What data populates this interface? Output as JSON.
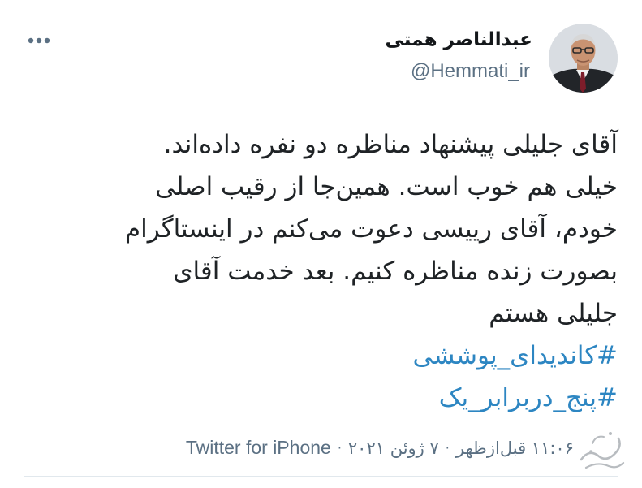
{
  "tweet": {
    "author_name": "عبدالناصر همتی",
    "author_handle": "@Hemmati_ir",
    "body_lines": [
      "آقای جلیلی پیشنهاد مناظره دو نفره داده‌اند.",
      "خیلی هم خوب است. همین‌جا از رقیب اصلی",
      "خودم، آقای رییسی دعوت می‌کنم در اینستاگرام",
      "بصورت زنده مناظره کنیم. بعد خدمت آقای",
      "جلیلی هستم"
    ],
    "hashtags": [
      "#کاندیدای_پوششی",
      "#پنج_دربرابر_یک"
    ],
    "time": "۱۱:۰۶ قبل‌ازظهر",
    "separator": "·",
    "date": "۷ ژوئن ۲۰۲۱",
    "source": "Twitter for iPhone"
  },
  "icons": {
    "more": "more-horizontal-icon",
    "avatar": "avatar-photo",
    "watermark": "calligraphy-watermark"
  },
  "colors": {
    "hashtag": "#2d86c2",
    "secondary_text": "#5b7083",
    "primary_text": "#14171a"
  }
}
